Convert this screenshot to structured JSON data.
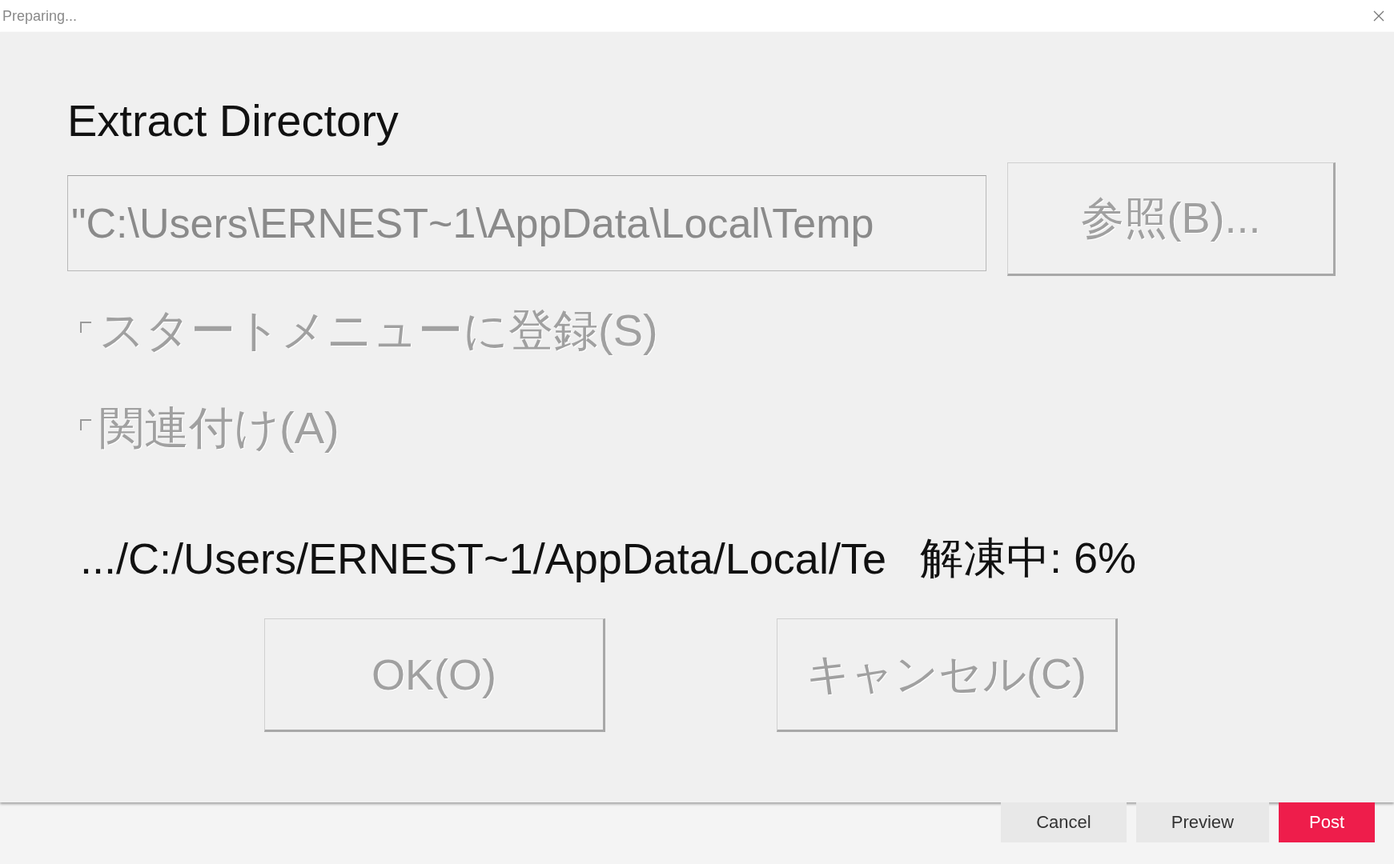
{
  "window": {
    "title": "Preparing..."
  },
  "dialog": {
    "heading": "Extract Directory",
    "directory_field": {
      "value": "\"C:\\Users\\ERNEST~1\\AppData\\Local\\Temp",
      "disabled": true
    },
    "browse_button": {
      "label": "参照(B)...",
      "disabled": true
    },
    "checkboxes": [
      {
        "label": "スタートメニューに登録(S)",
        "checked": false,
        "disabled": true
      },
      {
        "label": "関連付け(A)",
        "checked": false,
        "disabled": true
      }
    ],
    "status": {
      "path": ".../C:/Users/ERNEST~1/AppData/Local/Te",
      "progress": "解凍中: 6%"
    },
    "buttons": [
      {
        "label": "OK(O)",
        "disabled": true
      },
      {
        "label": "キャンセル(C)",
        "disabled": true
      }
    ]
  },
  "footer": {
    "buttons": [
      {
        "label": "Cancel",
        "kind": "plain"
      },
      {
        "label": "Preview",
        "kind": "plain"
      },
      {
        "label": "Post",
        "kind": "primary"
      }
    ]
  }
}
